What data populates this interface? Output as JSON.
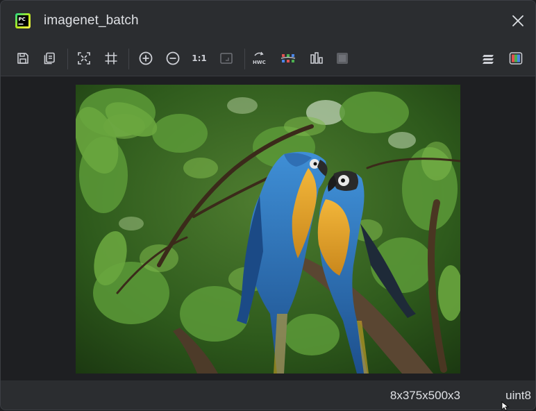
{
  "window": {
    "title": "imagenet_batch",
    "app_icon": {
      "name": "pycharm-icon",
      "text": "PC"
    }
  },
  "toolbar": {
    "left_groups": [
      [
        {
          "name": "save-icon",
          "tooltip": ""
        },
        {
          "name": "copy-icon",
          "tooltip": ""
        }
      ],
      [
        {
          "name": "fit-to-window-icon",
          "tooltip": ""
        },
        {
          "name": "grid-icon",
          "tooltip": ""
        }
      ],
      [
        {
          "name": "zoom-in-icon",
          "tooltip": ""
        },
        {
          "name": "zoom-out-icon",
          "tooltip": ""
        },
        {
          "name": "actual-size-icon",
          "label": "1:1"
        },
        {
          "name": "fit-image-icon",
          "tooltip": ""
        }
      ],
      [
        {
          "name": "hwc-layout-icon",
          "label": "HWC"
        },
        {
          "name": "rgb-channels-icon",
          "tooltip": ""
        },
        {
          "name": "histogram-icon",
          "tooltip": ""
        },
        {
          "name": "stop-icon",
          "tooltip": ""
        }
      ]
    ],
    "right": [
      {
        "name": "layers-icon"
      },
      {
        "name": "color-channels-icon"
      }
    ]
  },
  "status": {
    "shape": "8x375x500x3",
    "dtype": "uint8"
  },
  "colors": {
    "window_bg": "#2b2d30",
    "canvas_bg": "#1e1f22",
    "icon_gray": "#ced0d6",
    "text": "#dfe1e5",
    "macaw_blue": "#2f6fb4",
    "macaw_yellow": "#e0a52a",
    "foliage": "#3d6b25"
  }
}
